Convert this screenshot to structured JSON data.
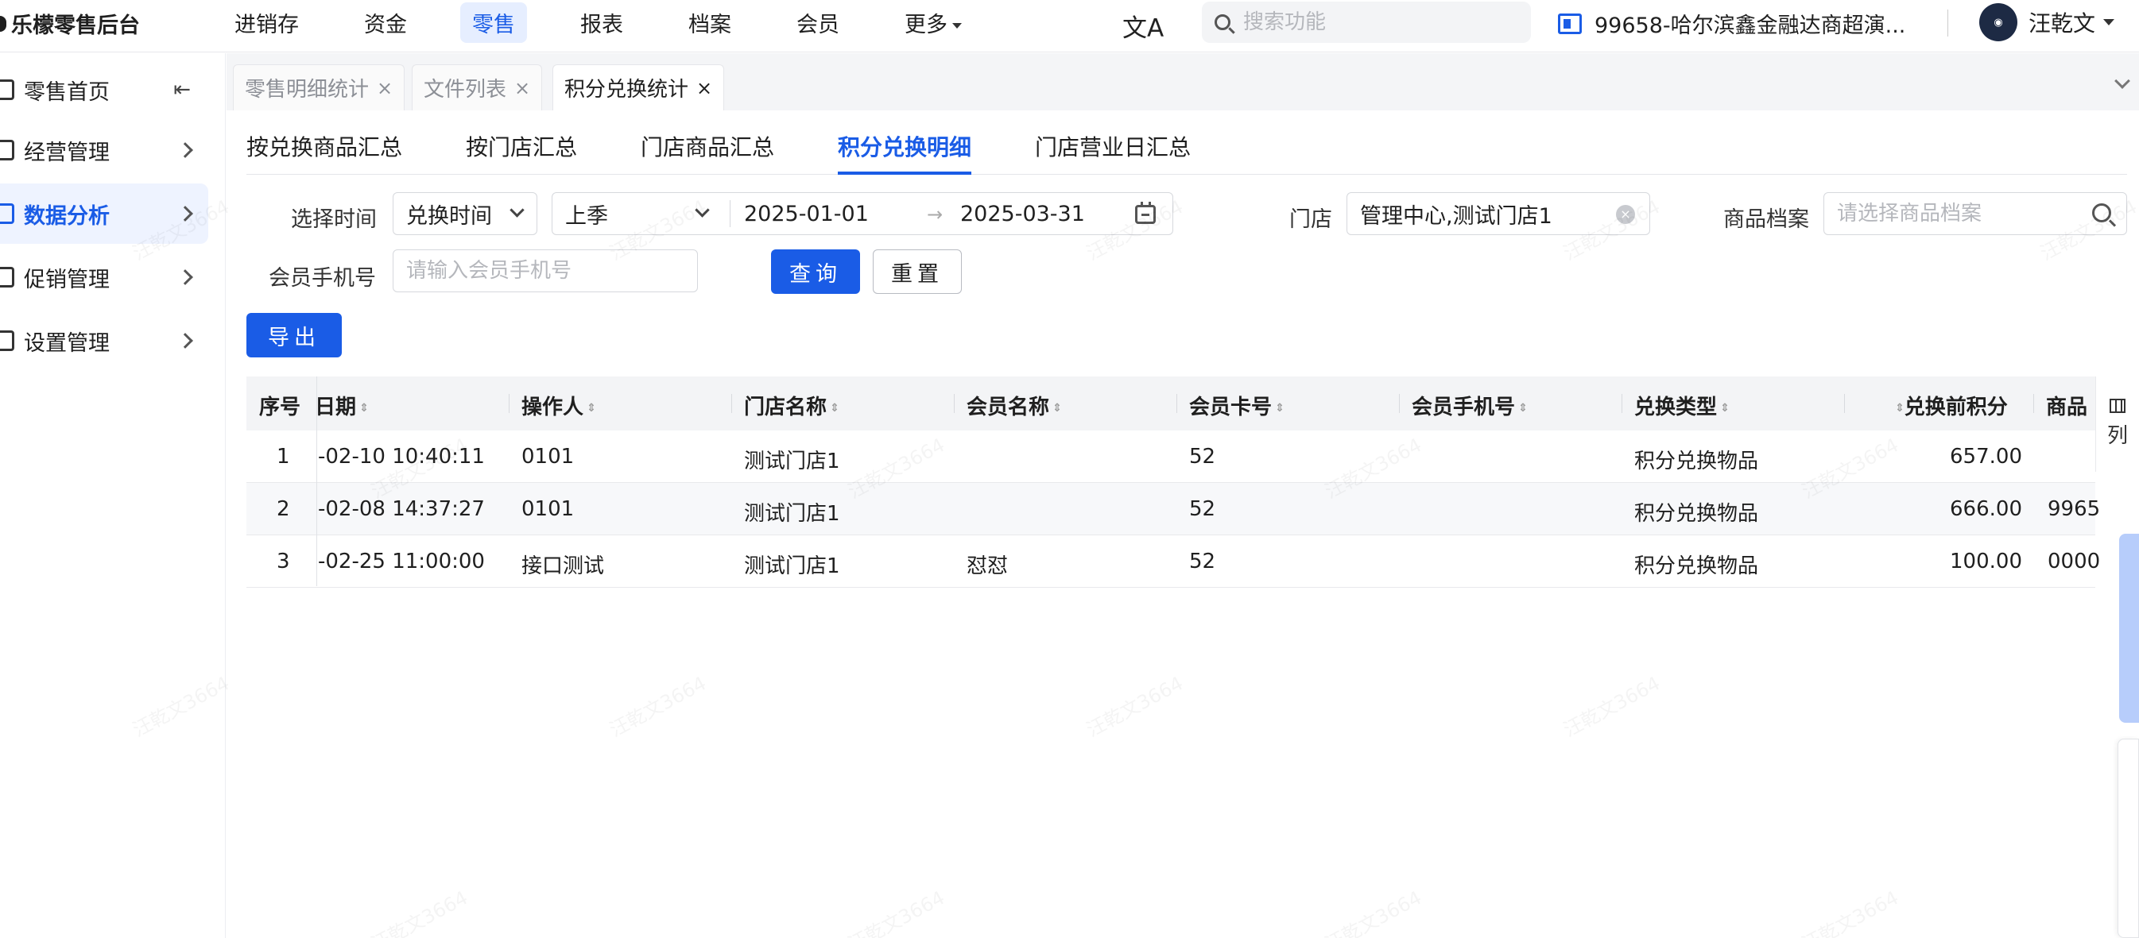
{
  "app": {
    "brand": "乐檬零售后台"
  },
  "top_nav": {
    "items": [
      "进销存",
      "资金",
      "零售",
      "报表",
      "档案",
      "会员",
      "更多"
    ],
    "active": "零售",
    "search_placeholder": "搜索功能",
    "store": "99658-哈尔滨鑫金融达商超演...",
    "user": "汪乾文"
  },
  "sidebar": {
    "items": [
      {
        "label": "零售首页"
      },
      {
        "label": "经营管理"
      },
      {
        "label": "数据分析"
      },
      {
        "label": "促销管理"
      },
      {
        "label": "设置管理"
      }
    ],
    "active": "数据分析"
  },
  "page_tabs": [
    {
      "label": "零售明细统计",
      "close": "×"
    },
    {
      "label": "文件列表",
      "close": "×"
    },
    {
      "label": "积分兑换统计",
      "close": "×"
    }
  ],
  "sub_tabs": [
    "按兑换商品汇总",
    "按门店汇总",
    "门店商品汇总",
    "积分兑换明细",
    "门店营业日汇总"
  ],
  "filters": {
    "time_label": "选择时间",
    "time_type": "兑换时间",
    "period": "上季",
    "date_start": "2025-01-01",
    "date_sep": "→",
    "date_end": "2025-03-31",
    "store_label": "门店",
    "store_value": "管理中心,测试门店1",
    "product_label": "商品档案",
    "product_placeholder": "请选择商品档案",
    "phone_label": "会员手机号",
    "phone_placeholder": "请输入会员手机号",
    "query_button": "查询",
    "reset_button": "重置",
    "export_button": "导出"
  },
  "table": {
    "columns": [
      "序号",
      "日期",
      "操作人",
      "门店名称",
      "会员名称",
      "会员卡号",
      "会员手机号",
      "兑换类型",
      "兑换前积分",
      "商品"
    ],
    "rows": [
      {
        "no": "1",
        "date": "-02-10 10:40:11",
        "operator": "0101",
        "store": "测试门店1",
        "member": "",
        "card": "52",
        "phone": "",
        "type": "积分兑换物品",
        "points_before": "657.00",
        "product": ""
      },
      {
        "no": "2",
        "date": "-02-08 14:37:27",
        "operator": "0101",
        "store": "测试门店1",
        "member": "",
        "card": "52",
        "phone": "",
        "type": "积分兑换物品",
        "points_before": "666.00",
        "product": "9965"
      },
      {
        "no": "3",
        "date": "-02-25 11:00:00",
        "operator": "接口测试",
        "store": "测试门店1",
        "member": "怼怼",
        "card": "52",
        "phone": "",
        "type": "积分兑换物品",
        "points_before": "100.00",
        "product": "0000"
      }
    ],
    "column_toggle": "列"
  },
  "watermark": "汪乾文3664"
}
